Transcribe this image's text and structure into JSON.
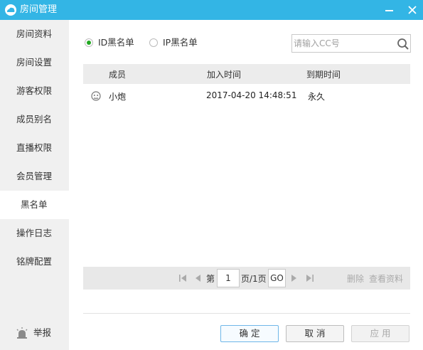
{
  "window": {
    "title": "房间管理",
    "logo_icon": "cc-cloud-logo-icon",
    "minimize_icon": "minimize-icon",
    "close_icon": "close-icon",
    "accent_color": "#33b5e5"
  },
  "sidebar": {
    "items": [
      {
        "label": "房间资料"
      },
      {
        "label": "房间设置"
      },
      {
        "label": "游客权限"
      },
      {
        "label": "成员别名"
      },
      {
        "label": "直播权限"
      },
      {
        "label": "会员管理"
      },
      {
        "label": "黑名单",
        "active": true
      },
      {
        "label": "操作日志"
      },
      {
        "label": "铭牌配置"
      }
    ],
    "report": {
      "label": "举报",
      "icon": "alarm-icon"
    }
  },
  "filter": {
    "options": [
      {
        "label": "ID黑名单",
        "selected": true
      },
      {
        "label": "IP黑名单",
        "selected": false
      }
    ],
    "search_placeholder": "请输入CC号",
    "search_icon": "search-icon"
  },
  "table": {
    "columns": [
      "成员",
      "加入时间",
      "到期时间"
    ],
    "rows": [
      {
        "avatar_icon": "user-avatar-icon",
        "member": "小炮",
        "joined": "2017-04-20 14:48:51",
        "expires": "永久"
      }
    ]
  },
  "pagination": {
    "prefix": "第",
    "current_page": "1",
    "suffix": "页/1页",
    "go_label": "GO",
    "delete_label": "删除",
    "view_profile_label": "查看资料"
  },
  "footer": {
    "confirm": "确 定",
    "cancel": "取 消",
    "apply": "应 用"
  }
}
